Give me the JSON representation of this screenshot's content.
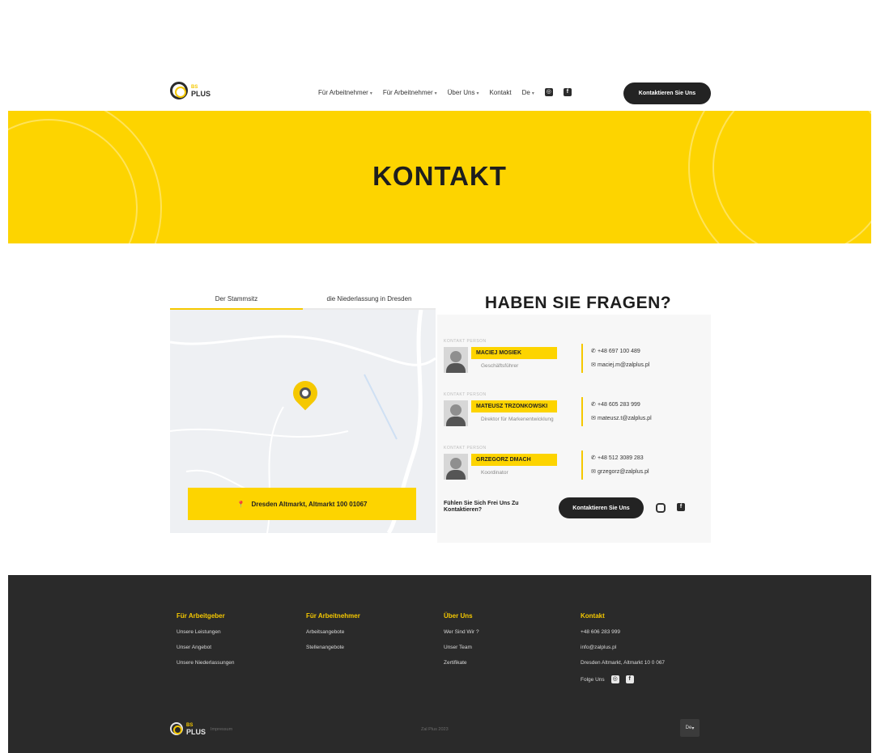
{
  "header": {
    "logo_top": "BS",
    "logo_bottom": "PLUS",
    "nav": [
      {
        "label": "Für Arbeitnehmer",
        "has_dropdown": true
      },
      {
        "label": "Für Arbeitnehmer",
        "has_dropdown": true
      },
      {
        "label": "Über Uns",
        "has_dropdown": true
      },
      {
        "label": "Kontakt",
        "has_dropdown": false
      }
    ],
    "lang": "De",
    "cta": "Kontaktieren Sie Uns"
  },
  "banner": {
    "title": "KONTAKT"
  },
  "map_section": {
    "tabs": [
      "Der Stammsitz",
      "die Niederlassung in Dresden"
    ],
    "active_tab": 0,
    "address": "Dresden Altmarkt, Altmarkt 100 01067"
  },
  "contact": {
    "heading": "HABEN SIE FRAGEN?",
    "people": [
      {
        "tag": "KONTAKT PERSON",
        "name": "MACIEJ MOSIEK",
        "title": "Geschäftsführer",
        "phone": "+48 697 100 489",
        "email": "maciej.m@zalplus.pl"
      },
      {
        "tag": "KONTAKT PERSON",
        "name": "MATEUSZ TRZONKOWSKI",
        "title": "Direktor für Markenentwicklung",
        "phone": "+48 605 283 999",
        "email": "mateusz.t@zalplus.pl"
      },
      {
        "tag": "KONTAKT PERSON",
        "name": "GRZEGORZ DMACH",
        "title": "Koordinator",
        "phone": "+48 512 3089 283",
        "email": "grzegorz@zalplus.pl"
      }
    ],
    "question": "Fühlen Sie Sich Frei Uns Zu Kontaktieren?",
    "cta": "Kontaktieren Sie Uns"
  },
  "footer": {
    "columns": [
      {
        "heading": "Für Arbeitgeber",
        "links": [
          "Unsere Leistungen",
          "Unser Angebot",
          "Unsere Niederlassungen"
        ]
      },
      {
        "heading": "Für Arbeitnehmer",
        "links": [
          "Arbeitsangebote",
          "Stellenangebote"
        ]
      },
      {
        "heading": "Über Uns",
        "links": [
          "Wer Sind Wir ?",
          "Unser Team",
          "Zertifikate"
        ]
      },
      {
        "heading": "Kontakt",
        "links": [
          "+48 606 283 999",
          "info@zalplus.pl",
          "Dresden Altmarkt, Altmarkt 10 0 067"
        ]
      }
    ],
    "follow_label": "Folge Uns",
    "bottom_left": "Impressum",
    "copyright": "Zal Plus 2023",
    "lang": "De"
  },
  "colors": {
    "accent": "#fdd400",
    "dark": "#2a2a2a"
  }
}
